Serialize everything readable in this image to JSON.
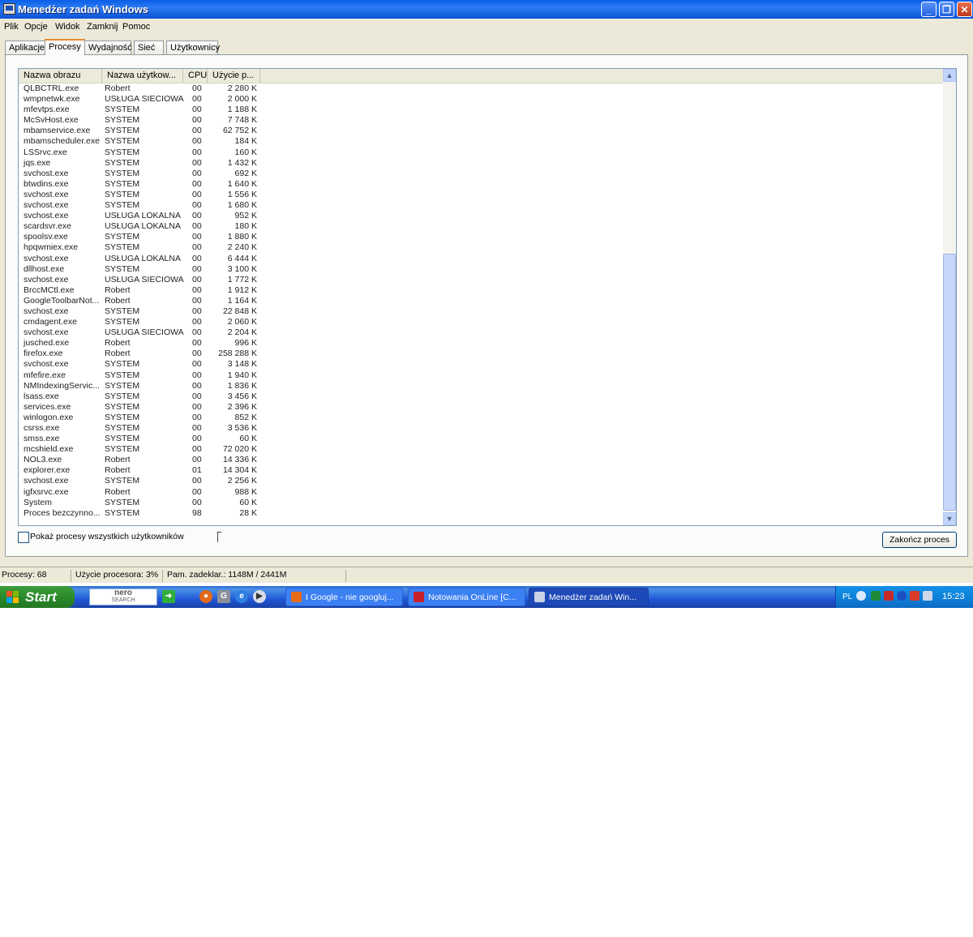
{
  "window": {
    "title": "Menedżer zadań Windows",
    "buttons": {
      "minimize": "_",
      "maximize": "❐",
      "close": "✕"
    }
  },
  "menu": [
    "Plik",
    "Opcje",
    "Widok",
    "Zamknij",
    "Pomoc"
  ],
  "tabs": [
    "Aplikacje",
    "Procesy",
    "Wydajność",
    "Sieć",
    "Użytkownicy"
  ],
  "active_tab": "Procesy",
  "columns": {
    "name": "Nazwa obrazu",
    "user": "Nazwa użytkow...",
    "cpu": "CPU",
    "mem": "Użycie p..."
  },
  "processes": [
    [
      "QLBCTRL.exe",
      "Robert",
      "00",
      "2 280 K"
    ],
    [
      "wmpnetwk.exe",
      "USŁUGA SIECIOWA",
      "00",
      "2 000 K"
    ],
    [
      "mfevtps.exe",
      "SYSTEM",
      "00",
      "1 188 K"
    ],
    [
      "McSvHost.exe",
      "SYSTEM",
      "00",
      "7 748 K"
    ],
    [
      "mbamservice.exe",
      "SYSTEM",
      "00",
      "62 752 K"
    ],
    [
      "mbamscheduler.exe",
      "SYSTEM",
      "00",
      "184 K"
    ],
    [
      "LSSrvc.exe",
      "SYSTEM",
      "00",
      "160 K"
    ],
    [
      "jqs.exe",
      "SYSTEM",
      "00",
      "1 432 K"
    ],
    [
      "svchost.exe",
      "SYSTEM",
      "00",
      "692 K"
    ],
    [
      "btwdins.exe",
      "SYSTEM",
      "00",
      "1 640 K"
    ],
    [
      "svchost.exe",
      "SYSTEM",
      "00",
      "1 556 K"
    ],
    [
      "svchost.exe",
      "SYSTEM",
      "00",
      "1 680 K"
    ],
    [
      "svchost.exe",
      "USŁUGA LOKALNA",
      "00",
      "952 K"
    ],
    [
      "scardsvr.exe",
      "USŁUGA LOKALNA",
      "00",
      "180 K"
    ],
    [
      "spoolsv.exe",
      "SYSTEM",
      "00",
      "1 880 K"
    ],
    [
      "hpqwmiex.exe",
      "SYSTEM",
      "00",
      "2 240 K"
    ],
    [
      "svchost.exe",
      "USŁUGA LOKALNA",
      "00",
      "6 444 K"
    ],
    [
      "dllhost.exe",
      "SYSTEM",
      "00",
      "3 100 K"
    ],
    [
      "svchost.exe",
      "USŁUGA SIECIOWA",
      "00",
      "1 772 K"
    ],
    [
      "BrccMCtl.exe",
      "Robert",
      "00",
      "1 912 K"
    ],
    [
      "GoogleToolbarNot...",
      "Robert",
      "00",
      "1 164 K"
    ],
    [
      "svchost.exe",
      "SYSTEM",
      "00",
      "22 848 K"
    ],
    [
      "cmdagent.exe",
      "SYSTEM",
      "00",
      "2 060 K"
    ],
    [
      "svchost.exe",
      "USŁUGA SIECIOWA",
      "00",
      "2 204 K"
    ],
    [
      "jusched.exe",
      "Robert",
      "00",
      "996 K"
    ],
    [
      "firefox.exe",
      "Robert",
      "00",
      "258 288 K"
    ],
    [
      "svchost.exe",
      "SYSTEM",
      "00",
      "3 148 K"
    ],
    [
      "mfefire.exe",
      "SYSTEM",
      "00",
      "1 940 K"
    ],
    [
      "NMIndexingServic...",
      "SYSTEM",
      "00",
      "1 836 K"
    ],
    [
      "lsass.exe",
      "SYSTEM",
      "00",
      "3 456 K"
    ],
    [
      "services.exe",
      "SYSTEM",
      "00",
      "2 396 K"
    ],
    [
      "winlogon.exe",
      "SYSTEM",
      "00",
      "852 K"
    ],
    [
      "csrss.exe",
      "SYSTEM",
      "00",
      "3 536 K"
    ],
    [
      "smss.exe",
      "SYSTEM",
      "00",
      "60 K"
    ],
    [
      "mcshield.exe",
      "SYSTEM",
      "00",
      "72 020 K"
    ],
    [
      "NOL3.exe",
      "Robert",
      "00",
      "14 336 K"
    ],
    [
      "explorer.exe",
      "Robert",
      "01",
      "14 304 K"
    ],
    [
      "svchost.exe",
      "SYSTEM",
      "00",
      "2 256 K"
    ],
    [
      "igfxsrvc.exe",
      "Robert",
      "00",
      "988 K"
    ],
    [
      "System",
      "SYSTEM",
      "00",
      "60 K"
    ],
    [
      "Proces bezczynno...",
      "SYSTEM",
      "98",
      "28 K"
    ]
  ],
  "show_all_users": {
    "label": "Pokaż procesy wszystkich użytkowników",
    "checked": false
  },
  "end_process_button": "Zakończ proces",
  "status": {
    "processes": "Procesy: 68",
    "cpu": "Użycie procesora: 3%",
    "memory": "Pam. zadeklar.: 1148M / 2441M"
  },
  "taskbar": {
    "start": "Start",
    "nero_top": "nero",
    "nero_bottom": "SEARCH",
    "tasks": [
      {
        "label": "I Google - nie googluj...",
        "icon": "firefox-icon",
        "color": "#e86a1b"
      },
      {
        "label": "Notowania OnLine [C...",
        "icon": "notowania-icon",
        "color": "#c8202a"
      },
      {
        "label": "Menedżer zadań Win...",
        "icon": "taskmgr-icon",
        "color": "#c9d3e6"
      }
    ],
    "language": "PL",
    "clock": "15:23"
  }
}
